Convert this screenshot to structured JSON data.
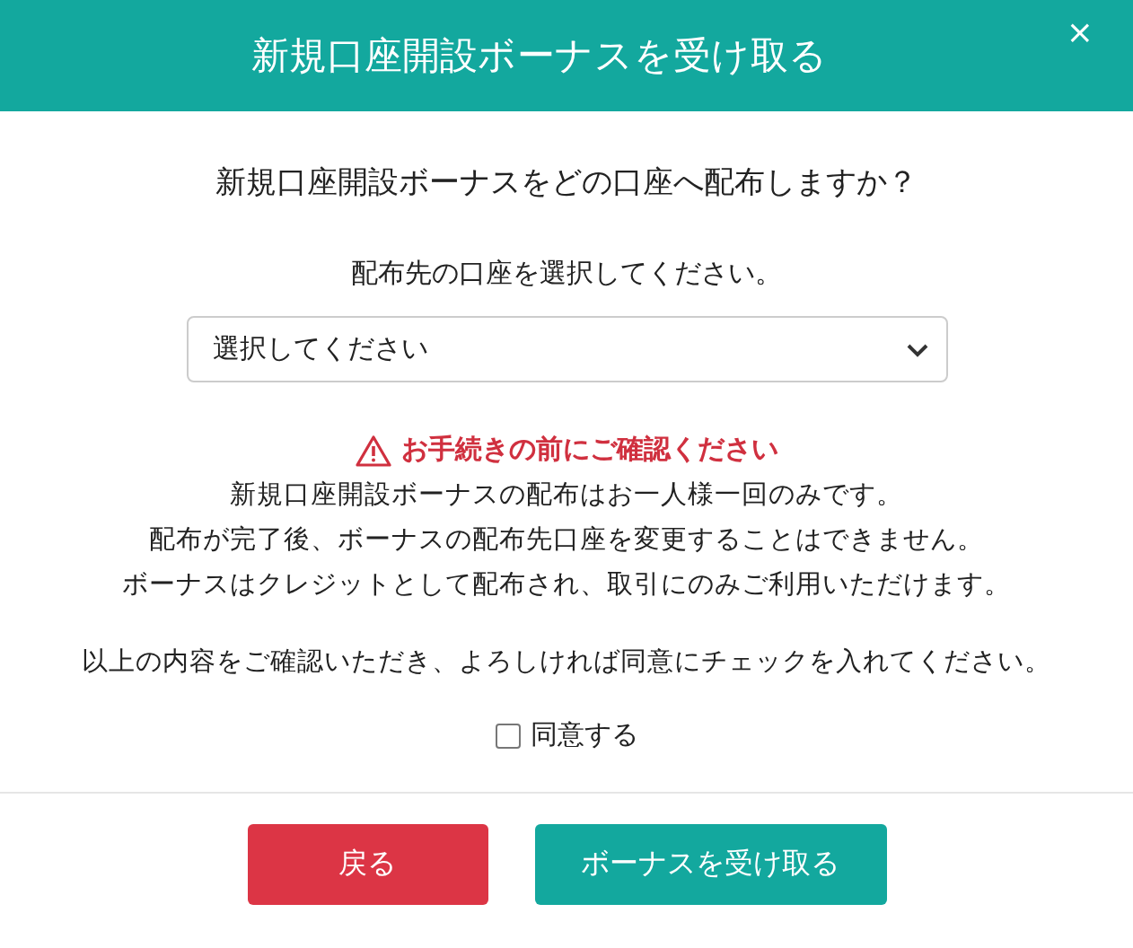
{
  "dialog": {
    "title": "新規口座開設ボーナスを受け取る",
    "close": "×"
  },
  "question": "新規口座開設ボーナスをどの口座へ配布しますか？",
  "account_select": {
    "label": "配布先の口座を選択してください。",
    "value": "選択してください"
  },
  "notice": {
    "heading": "お手続きの前にご確認ください",
    "lines": [
      "新規口座開設ボーナスの配布はお一人様一回のみです。",
      "配布が完了後、ボーナスの配布先口座を変更することはできません。",
      "ボーナスはクレジットとして配布され、取引にのみご利用いただけます。"
    ]
  },
  "consent_text": "以上の内容をご確認いただき、よろしければ同意にチェックを入れてください。",
  "agree": {
    "label": "同意する",
    "checked": false
  },
  "buttons": [
    {
      "label": "戻る",
      "kind": "back"
    },
    {
      "label": "ボーナスを受け取る",
      "kind": "primary"
    }
  ]
}
